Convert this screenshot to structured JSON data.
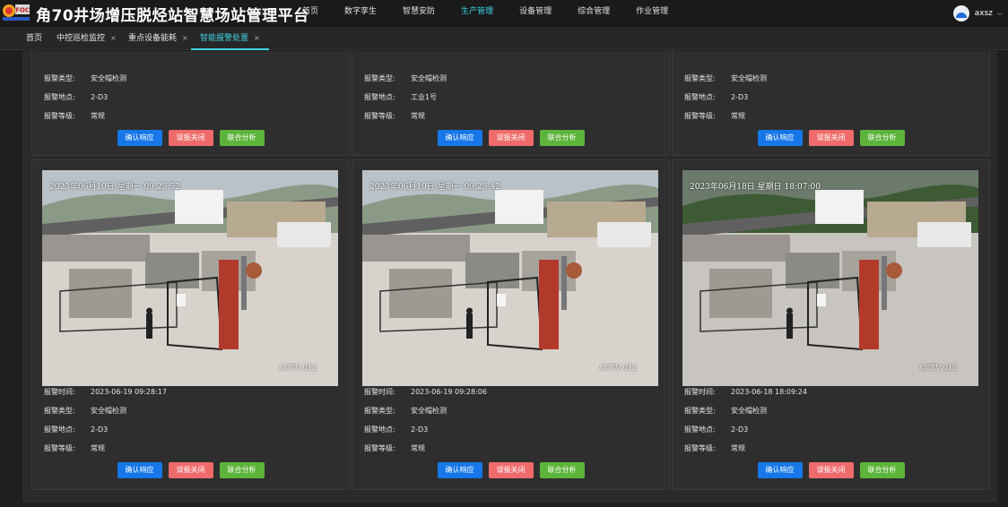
{
  "app": {
    "title": "角70井场增压脱烃站智慧场站管理平台",
    "logo_text": "FOC"
  },
  "nav": {
    "items": [
      "首页",
      "数字孪生",
      "智慧安防",
      "生产管理",
      "设备管理",
      "综合管理",
      "作业管理"
    ],
    "active_index": 3
  },
  "user": {
    "name": "axsz",
    "chevron": "chevron-down-icon"
  },
  "tabs": {
    "items": [
      {
        "label": "首页",
        "closable": false
      },
      {
        "label": "中控巡检监控",
        "closable": true
      },
      {
        "label": "重点设备能耗",
        "closable": true
      },
      {
        "label": "智能报警处置",
        "closable": true
      }
    ],
    "active_index": 3,
    "close_glyph": "×"
  },
  "labels": {
    "time": "报警时间:",
    "type": "报警类型:",
    "location": "报警地点:",
    "level": "报警等级:"
  },
  "buttons": {
    "confirm": "确认响应",
    "false_alarm": "误报关闭",
    "analyze": "联合分析"
  },
  "top_cards": [
    {
      "type": "安全帽检测",
      "location": "2-D3",
      "level": "常规"
    },
    {
      "type": "安全帽检测",
      "location": "工业1号",
      "level": "常规"
    },
    {
      "type": "安全帽检测",
      "location": "2-D3",
      "level": "常规"
    }
  ],
  "alarm_cards": [
    {
      "timestamp_overlay": "2023年06月19日 星期一 09:25:52",
      "camera": "CCTV 012",
      "time": "2023-06-19 09:28:17",
      "type": "安全帽检测",
      "location": "2-D3",
      "level": "常规"
    },
    {
      "timestamp_overlay": "2023年06月19日 星期一 09:25:42",
      "camera": "CCTV 012",
      "time": "2023-06-19 09:28:06",
      "type": "安全帽检测",
      "location": "2-D3",
      "level": "常规"
    },
    {
      "timestamp_overlay": "2023年06月18日 星期日 18:07:00",
      "camera": "CCTV 012",
      "time": "2023-06-18 18:09:24",
      "type": "安全帽检测",
      "location": "2-D3",
      "level": "常规"
    }
  ],
  "colors": {
    "accent": "#3fd3e6",
    "confirm": "#1577e8",
    "false_alarm": "#ef6b6b",
    "analyze": "#5cb43a"
  }
}
